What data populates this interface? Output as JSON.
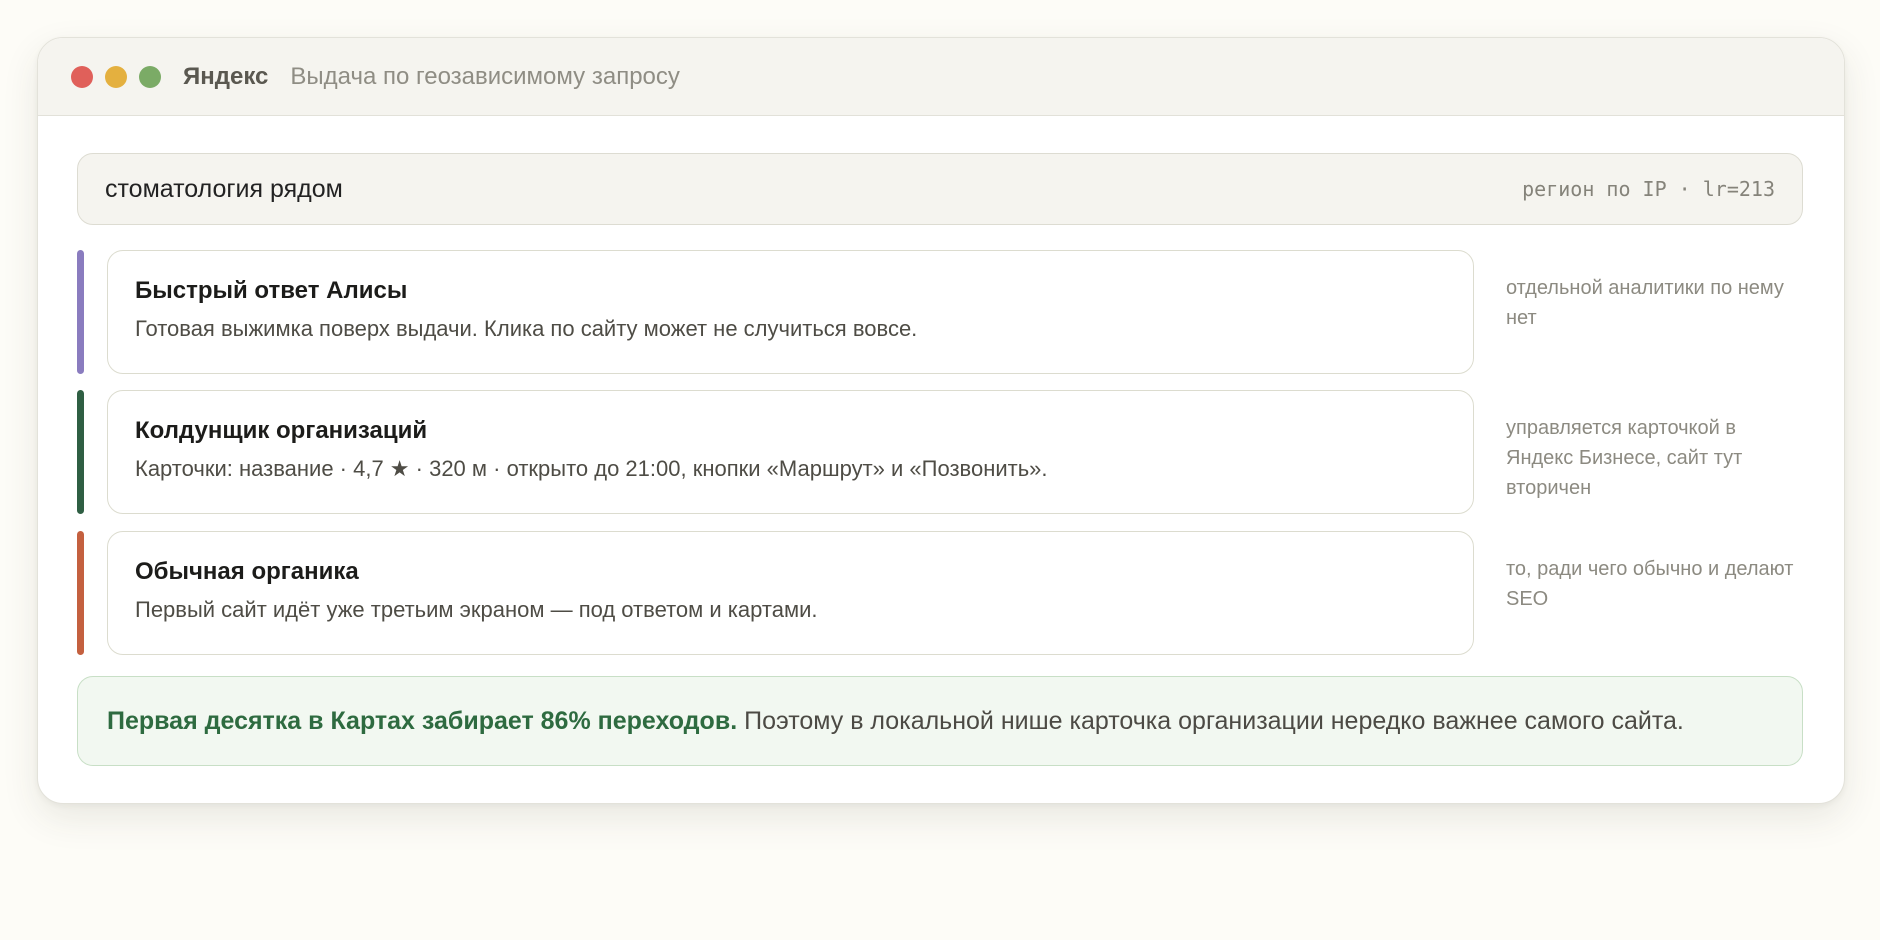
{
  "window": {
    "brand": "Яндекс",
    "subtitle": "Выдача по геозависимому запросу",
    "controls": [
      "close",
      "minimize",
      "maximize"
    ]
  },
  "search": {
    "query": "стоматология рядом",
    "region": "регион по IP · lr=213"
  },
  "results": [
    {
      "title": "Быстрый ответ Алисы",
      "description": "Готовая выжимка поверх выдачи. Клика по сайту может не случиться вовсе.",
      "note": "отдельной аналитики по нему нет",
      "accent_color": "#8a7cbf"
    },
    {
      "title": "Колдунщик организаций",
      "description": "Карточки: название · 4,7 ★ · 320 м · открыто до 21:00, кнопки «Маршрут» и «Позвонить».",
      "note": "управляется карточкой в Яндекс Бизнесе, сайт тут вторичен",
      "accent_color": "#2f5f43"
    },
    {
      "title": "Обычная органика",
      "description": "Первый сайт идёт уже третьим экраном — под ответом и картами.",
      "note": "то, ради чего обычно и делают SEO",
      "accent_color": "#c4603f"
    }
  ],
  "callout": {
    "strong": "Первая десятка в Картах забирает 86% переходов.",
    "text": "Поэтому в локальной нише карточка организации нередко важнее самого сайта."
  },
  "colors": {
    "close": "#e0605a",
    "minimize": "#e4b03f",
    "maximize": "#7bab66",
    "callout_accent": "#2e6b40"
  }
}
